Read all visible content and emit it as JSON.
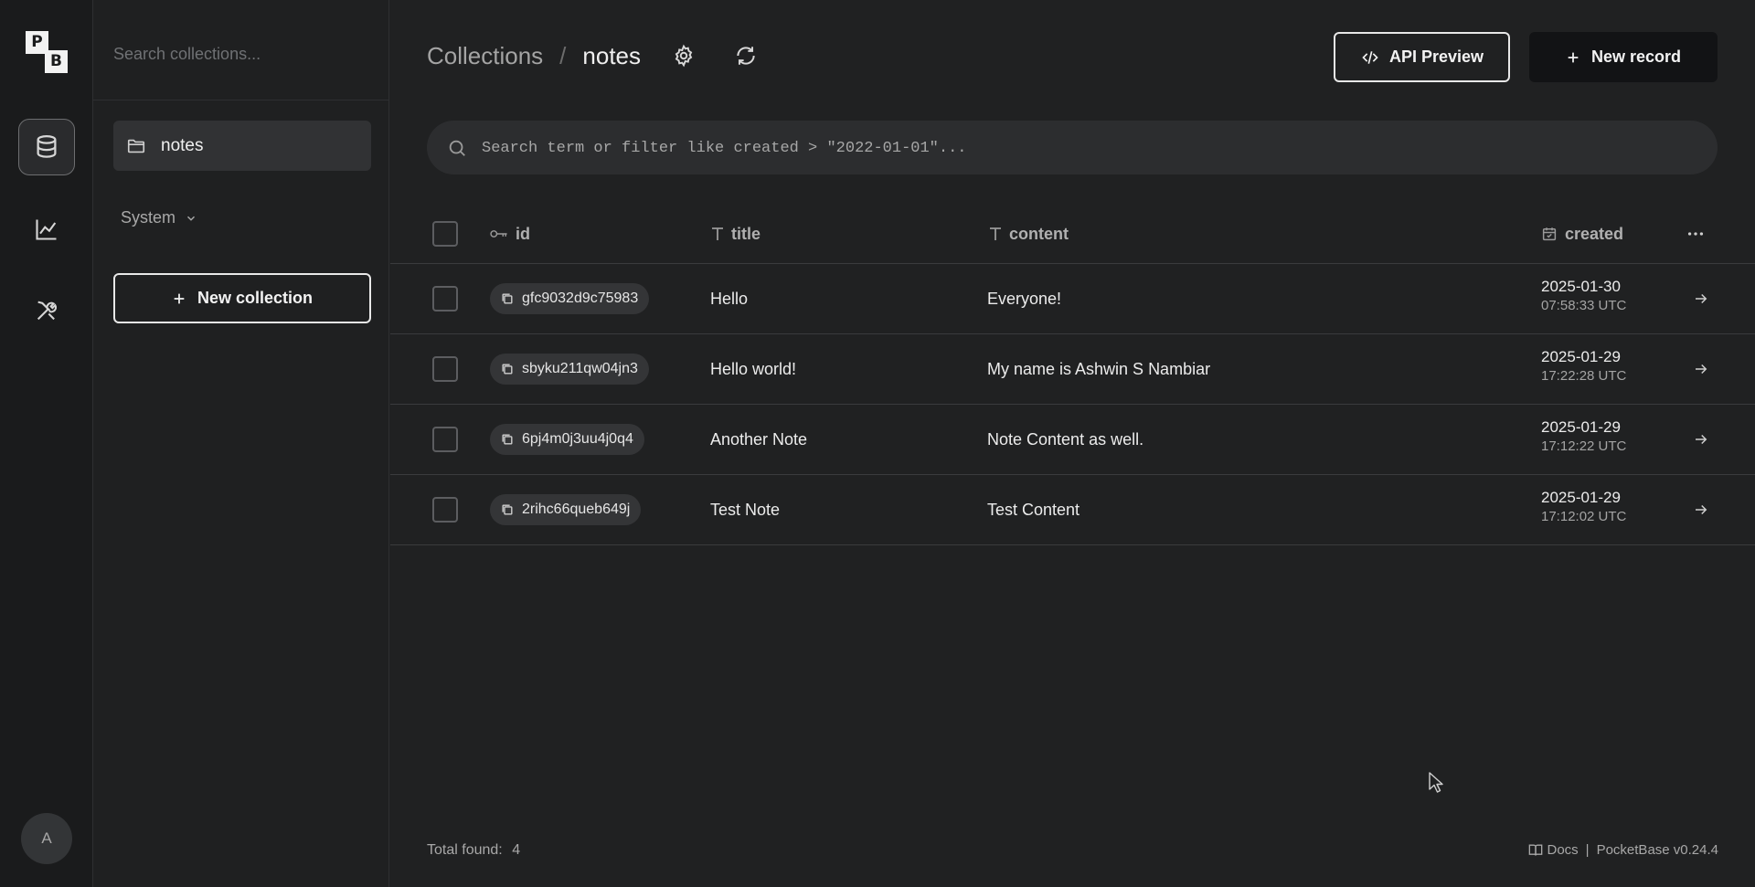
{
  "brand": {
    "logo_p": "P",
    "logo_b": "B"
  },
  "rail": {
    "items": [
      {
        "name": "collections",
        "icon": "database-icon",
        "active": true
      },
      {
        "name": "logs",
        "icon": "chart-line-icon",
        "active": false
      },
      {
        "name": "settings",
        "icon": "tools-icon",
        "active": false
      }
    ],
    "avatar_letter": "A"
  },
  "sidebar": {
    "search_placeholder": "Search collections...",
    "collections": [
      {
        "label": "notes",
        "icon": "folder-icon",
        "active": true
      }
    ],
    "system_label": "System",
    "new_collection_label": "New collection"
  },
  "header": {
    "breadcrumb_root": "Collections",
    "breadcrumb_sep": "/",
    "breadcrumb_current": "notes",
    "api_preview_label": "API Preview",
    "new_record_label": "New record"
  },
  "filter": {
    "placeholder": "Search term or filter like created > \"2022-01-01\"..."
  },
  "table": {
    "columns": {
      "id": "id",
      "title": "title",
      "content": "content",
      "created": "created"
    },
    "rows": [
      {
        "id": "gfc9032d9c75983",
        "title": "Hello",
        "content": "Everyone!",
        "date": "2025-01-30",
        "time": "07:58:33 UTC"
      },
      {
        "id": "sbyku211qw04jn3",
        "title": "Hello world!",
        "content": "My name is Ashwin S Nambiar",
        "date": "2025-01-29",
        "time": "17:22:28 UTC"
      },
      {
        "id": "6pj4m0j3uu4j0q4",
        "title": "Another Note",
        "content": "Note Content as well.",
        "date": "2025-01-29",
        "time": "17:12:22 UTC"
      },
      {
        "id": "2rihc66queb649j",
        "title": "Test Note",
        "content": "Test Content",
        "date": "2025-01-29",
        "time": "17:12:02 UTC"
      }
    ]
  },
  "footer": {
    "total_label": "Total found:",
    "total_value": "4",
    "docs_label": "Docs",
    "separator": "|",
    "version_label": "PocketBase v0.24.4"
  }
}
